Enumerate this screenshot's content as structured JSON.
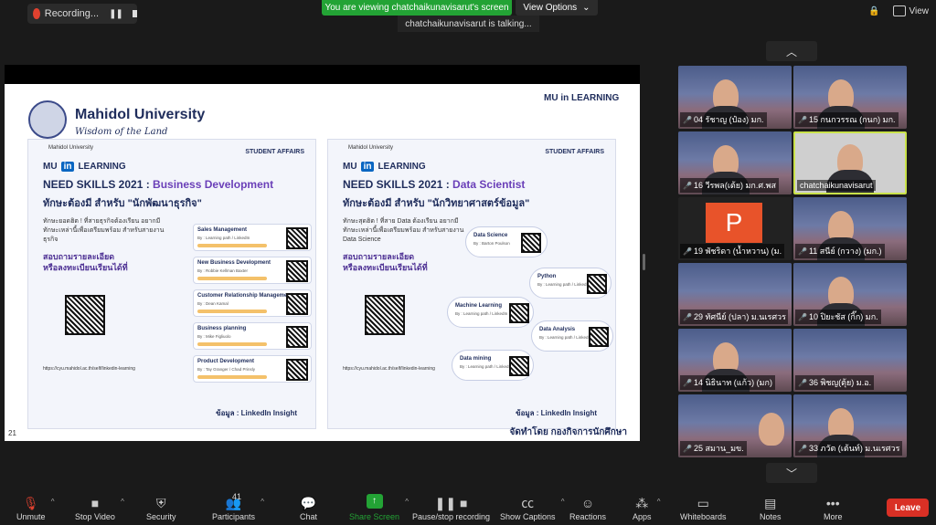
{
  "topbar": {
    "recording_label": "Recording...",
    "viewing_banner": "You are viewing chatchaikunavisarut's screen",
    "view_options_label": "View Options",
    "talking_indicator": "chatchaikunavisarut is talking...",
    "view_label": "View"
  },
  "slide": {
    "university_name": "Mahidol University",
    "university_sub": "Wisdom of the Land",
    "top_logo": "MU in LEARNING",
    "slide_number": "21",
    "made_by": "จัดทำโดย กองกิจการนักศึกษา",
    "left_panel": {
      "small": "Mahidol University",
      "student_affairs": "STUDENT AFFAIRS",
      "brand_mu": "MU",
      "brand_in": "in",
      "brand_learning": "LEARNING",
      "title_main": "NEED SKILLS 2021 : ",
      "title_accent": "Business Development",
      "thai_title": "ทักษะต้องมี สำหรับ \"นักพัฒนาธุรกิจ\"",
      "desc": "ทักษะยอดฮิต ! ที่สายธุรกิจต้องเรียน อยากมีทักษะเหล่านี้เพื่อเตรียมพร้อม สำหรับสายงานธุรกิจ",
      "ask_line1": "สอบถามรายละเอียด",
      "ask_line2": "หรือลงทะเบียนเรียนได้ที่",
      "url": "https://cyu.mahidol.ac.th/self/linkedin-learning",
      "insight": "ข้อมูล : LinkedIn Insight",
      "cards": [
        {
          "title": "Sales Management",
          "by": "By : Learning path / LinkedIn"
        },
        {
          "title": "New Business Development",
          "by": "By : Robbie Kellman Baxter"
        },
        {
          "title": "Customer Relationship Management",
          "by": "By : Dean Kamal"
        },
        {
          "title": "Business planning",
          "by": "By : Mike Figliuolo"
        },
        {
          "title": "Product Development",
          "by": "By : Tay Granger / Chad Prinsly"
        }
      ]
    },
    "right_panel": {
      "small": "Mahidol University",
      "student_affairs": "STUDENT AFFAIRS",
      "brand_mu": "MU",
      "brand_in": "in",
      "brand_learning": "LEARNING",
      "title_main": "NEED SKILLS 2021 : ",
      "title_accent": "Data Scientist",
      "thai_title": "ทักษะต้องมี สำหรับ \"นักวิทยาศาสตร์ข้อมูล\"",
      "desc": "ทักษะสุดฮิต ! ที่สาย Data ต้องเรียน อยากมีทักษะเหล่านี้เพื่อเตรียมพร้อม สำหรับสายงาน Data Science",
      "ask_line1": "สอบถามรายละเอียด",
      "ask_line2": "หรือลงทะเบียนเรียนได้ที่",
      "url": "https://cyu.mahidol.ac.th/self/linkedin-learning",
      "insight": "ข้อมูล : LinkedIn Insight",
      "clouds": [
        {
          "title": "Data Science",
          "by": "By : Barton Poulson"
        },
        {
          "title": "Python",
          "by": "By : Learning path / LinkedIn"
        },
        {
          "title": "Machine Learning",
          "by": "By : Learning path / LinkedIn"
        },
        {
          "title": "Data Analysis",
          "by": "By : Learning path / LinkedIn"
        },
        {
          "title": "Data mining",
          "by": "By : Learning path / LinkedIn"
        }
      ]
    }
  },
  "participants": [
    {
      "name": "04 รัชาญ (ป๋อง) มก.",
      "kind": "video"
    },
    {
      "name": "15 กนกวรรณ (กนก) มก.",
      "kind": "video"
    },
    {
      "name": "16 วีรพล(เต้ย) มก.ศ.พส",
      "kind": "video"
    },
    {
      "name": "chatchaikunavisarut",
      "kind": "active"
    },
    {
      "name": "19 พัชริดา (น้ำหวาน) (ม.",
      "kind": "avatar",
      "avatar": "P"
    },
    {
      "name": "11 สนีย์ (กวาง) (มก.)",
      "kind": "video"
    },
    {
      "name": "29 ทัศนีย์ (ปลา) ม.นเรศวร",
      "kind": "video"
    },
    {
      "name": "10 ปิยะชัส (กิ๊ก) มก.",
      "kind": "video"
    },
    {
      "name": "14 นิธินาท (แก้ว) (มก)",
      "kind": "video"
    },
    {
      "name": "36 พิชญ(ตุ้ย) ม.อ.",
      "kind": "video"
    },
    {
      "name": "25 สมาน_มข.",
      "kind": "video"
    },
    {
      "name": "33 ภวัต (เต้นท์) ม.นเรศวร",
      "kind": "video"
    }
  ],
  "toolbar": {
    "unmute": "Unmute",
    "stop_video": "Stop Video",
    "security": "Security",
    "participants": "Participants",
    "participants_count": "41",
    "chat": "Chat",
    "share_screen": "Share Screen",
    "pause_recording": "Pause/stop recording",
    "show_captions": "Show Captions",
    "reactions": "Reactions",
    "apps": "Apps",
    "whiteboards": "Whiteboards",
    "notes": "Notes",
    "more": "More",
    "leave": "Leave"
  },
  "colors": {
    "share_green": "#23a335",
    "leave_red": "#d93025",
    "active_border": "#c9e24a",
    "slide_navy": "#1f2d5c"
  }
}
